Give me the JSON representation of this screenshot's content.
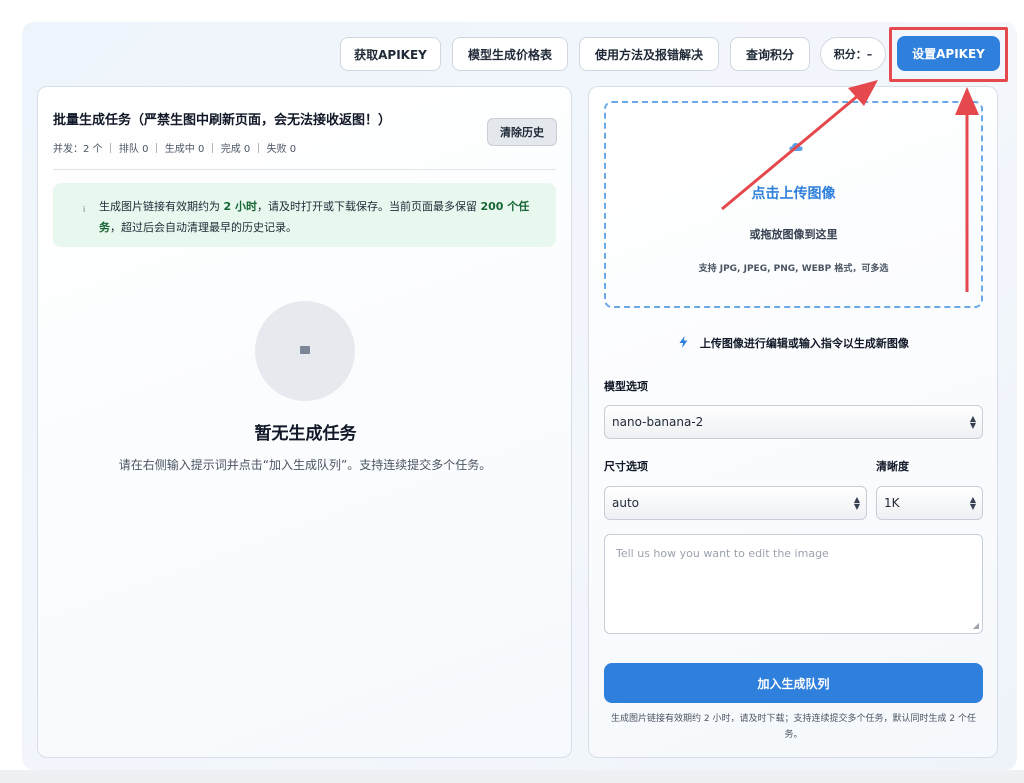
{
  "topbar": {
    "get_apikey": "获取APIKEY",
    "price_table": "模型生成价格表",
    "usage_help": "使用方法及报错解决",
    "query_credits": "查询积分",
    "credits_label": "积分：–",
    "set_apikey": "设置APIKEY"
  },
  "left_panel": {
    "title": "批量生成任务（严禁生图中刷新页面，会无法接收返图！）",
    "stats": "并发：2 个 ｜ 排队 0 ｜ 生成中 0 ｜ 完成 0 ｜ 失败 0",
    "clear_history": "清除历史",
    "notice": {
      "icon": "i",
      "part1": "生成图片链接有效期约为 ",
      "bold1": "2 小时",
      "part2": "，请及时打开或下载保存。当前页面最多保留 ",
      "bold2": "200 个任务",
      "part3": "，超过后会自动清理最早的历史记录。"
    },
    "empty_title": "暂无生成任务",
    "empty_desc": "请在右侧输入提示词并点击“加入生成队列”。支持连续提交多个任务。"
  },
  "right_panel": {
    "upload_title": "点击上传图像",
    "upload_sub": "或拖放图像到这里",
    "upload_formats": "支持 JPG, JPEG, PNG, WEBP 格式，可多选",
    "hint": "上传图像进行编辑或输入指令以生成新图像",
    "model_label": "模型选项",
    "model_value": "nano-banana-2",
    "size_label": "尺寸选项",
    "size_value": "auto",
    "clarity_label": "清晰度",
    "clarity_value": "1K",
    "prompt_placeholder": "Tell us how you want to edit the image",
    "queue_button": "加入生成队列",
    "footnote": "生成图片链接有效期约 2 小时，请及时下载；支持连续提交多个任务，默认同时生成 2 个任务。"
  },
  "colors": {
    "accent": "#2f7fdc",
    "annotation_red": "#e5484d",
    "notice_bg": "#e8f8ee"
  },
  "icons": [
    "info-icon",
    "image-placeholder-icon",
    "cloud-upload-icon",
    "bolt-icon",
    "select-arrow-icon",
    "resize-grip-icon"
  ]
}
